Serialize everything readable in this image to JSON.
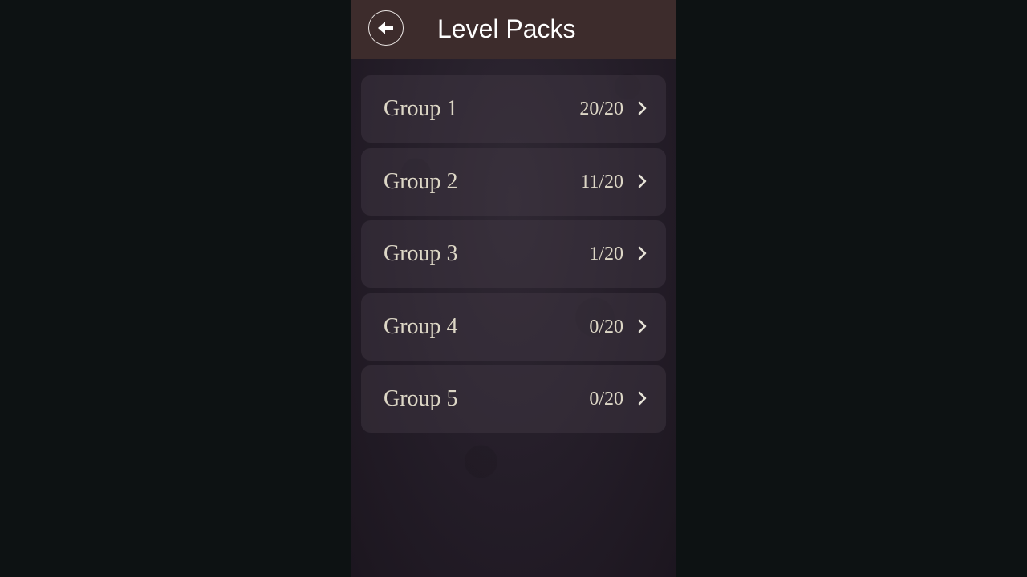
{
  "header": {
    "title": "Level Packs",
    "back_icon": "back-arrow-icon"
  },
  "groups": [
    {
      "label": "Group 1",
      "progress": "20/20"
    },
    {
      "label": "Group 2",
      "progress": "11/20"
    },
    {
      "label": "Group 3",
      "progress": "1/20"
    },
    {
      "label": "Group 4",
      "progress": "0/20"
    },
    {
      "label": "Group 5",
      "progress": "0/20"
    }
  ],
  "colors": {
    "header_bg": "#3d2c2c",
    "page_bg": "#241d28",
    "text": "#ddd7c6",
    "outer_bg": "#0d1213"
  }
}
